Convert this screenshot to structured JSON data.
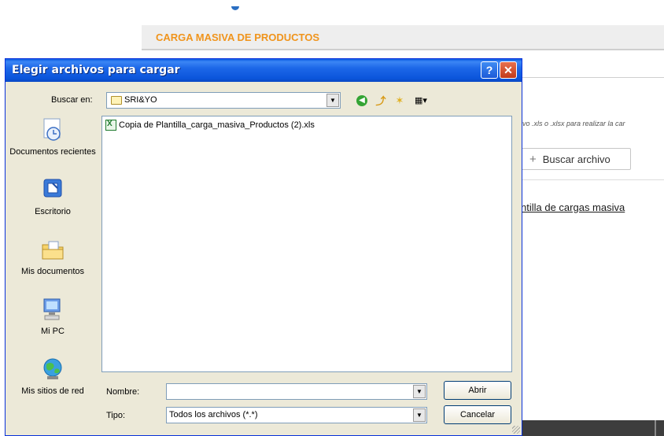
{
  "background": {
    "header_title": "CARGA MASIVA DE PRODUCTOS",
    "hint_text": "ivo .xls o .xlsx para realizar la car",
    "search_button_label": "Buscar archivo",
    "template_link": "ntilla de cargas masiva"
  },
  "dialog": {
    "title": "Elegir archivos para cargar",
    "help_glyph": "?",
    "close_glyph": "✕",
    "look_in_label": "Buscar en:",
    "look_in_value": "SRI&YO",
    "toolbar": {
      "back_icon": "back-icon",
      "up_icon": "up-folder-icon",
      "new_folder_icon": "new-folder-icon",
      "view_menu_icon": "view-menu-icon"
    },
    "places": [
      {
        "label": "Documentos recientes",
        "icon": "recent-documents-icon"
      },
      {
        "label": "Escritorio",
        "icon": "desktop-icon"
      },
      {
        "label": "Mis documentos",
        "icon": "my-documents-icon"
      },
      {
        "label": "Mi PC",
        "icon": "my-computer-icon"
      },
      {
        "label": "Mis sitios de red",
        "icon": "network-places-icon"
      }
    ],
    "files": [
      {
        "name": "Copia de Plantilla_carga_masiva_Productos (2).xls",
        "icon": "excel-file-icon"
      }
    ],
    "file_name_label": "Nombre:",
    "file_name_value": "",
    "file_type_label": "Tipo:",
    "file_type_value": "Todos los archivos (*.*)",
    "open_button": "Abrir",
    "cancel_button": "Cancelar"
  }
}
